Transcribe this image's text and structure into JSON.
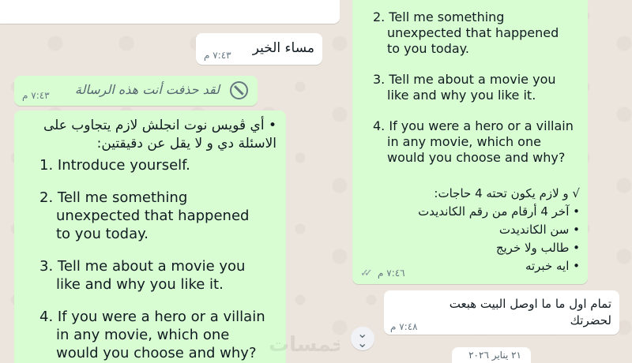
{
  "left_panel": {
    "greeting": {
      "text": "مساء الخير",
      "time": "٧:٤٣ م"
    },
    "deleted": {
      "text": "لقد حذفت أنت هذه الرسالة",
      "time": "٧:٤٣ م"
    },
    "instructions": {
      "bullet": "•",
      "intro_line1": "أي ڤويس نوت انجلش لازم يتجاوب على",
      "intro_line2": "الاسئلة دي و لا يقل عن دقيقتين:",
      "q1": "1. Introduce yourself.",
      "q2_line1": "2. Tell me something",
      "q2_line2": "unexpected that happened",
      "q2_line3": "to you today.",
      "q3_line1": "3. Tell me about a movie you",
      "q3_line2": "like and why you like it.",
      "q4_line1": "4. If you were a hero or a villain",
      "q4_line2": "in any movie, which one",
      "q4_line3": "would you choose and why?"
    },
    "watermark": "خمسات"
  },
  "right_panel": {
    "instructions": {
      "q2_line1": "2. Tell me something",
      "q2_line2": "unexpected that happened",
      "q2_line3": "to you today.",
      "q3_line1": "3. Tell me about a movie you",
      "q3_line2": "like and why you like it.",
      "q4_line1": "4. If you were a hero or a villain",
      "q4_line2": "in any movie, which one",
      "q4_line3": "would you choose and why?",
      "requirements_title": "√ و لازم يكون تحته 4 حاجات:",
      "req1": "• آخر 4 أرقام من رقم الكانديدت",
      "req2": "• سن الكانديدت",
      "req3": "• طالب ولا خريج",
      "req4": "• ايه خبرته",
      "time": "٧:٤٦ م"
    },
    "reply": {
      "line1": "تمام اول ما ما اوصل البيت هبعت",
      "line2": "لحضرتك",
      "time": "٧:٤٨ م"
    },
    "date_label": "٢١ يناير ٢٠٢٦"
  },
  "colors": {
    "outgoing_bubble": "#d9fdd3",
    "incoming_bubble": "#ffffff",
    "chat_background": "#ece5dd",
    "read_ticks": "#8696a0"
  }
}
